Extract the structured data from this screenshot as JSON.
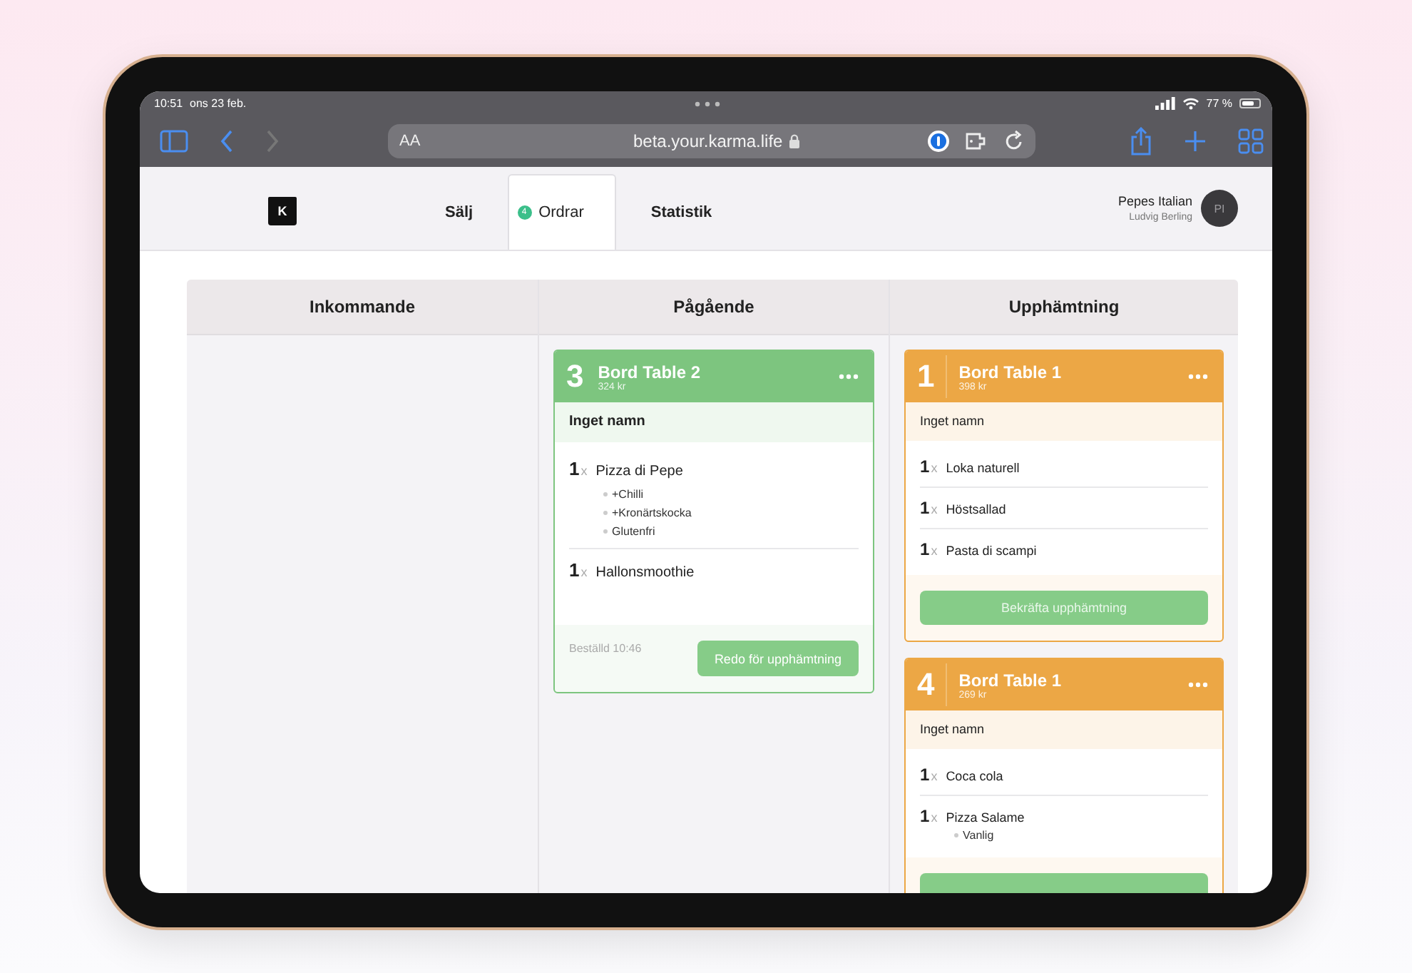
{
  "status_bar": {
    "time": "10:51",
    "date": "ons 23 feb.",
    "battery": "77 %"
  },
  "browser": {
    "text_size": "AA",
    "url": "beta.your.karma.life"
  },
  "nav": {
    "logo_letter": "K",
    "tabs": [
      {
        "label": "Sälj",
        "selected": false
      },
      {
        "label": "Ordrar",
        "badge": "4",
        "selected": true
      },
      {
        "label": "Statistik",
        "selected": false
      }
    ],
    "account": {
      "name": "Pepes Italian",
      "user": "Ludvig Berling",
      "initials": "PI"
    }
  },
  "board": {
    "columns": [
      {
        "title": "Inkommande"
      },
      {
        "title": "Pågående",
        "orders": [
          {
            "number": "3",
            "table": "Bord Table 2",
            "price": "324 kr",
            "color": "#7dc57f",
            "customer": "Inget namn",
            "items": [
              {
                "qty": "1",
                "unit": "x",
                "name": "Pizza di Pepe",
                "options": [
                  "+Chilli",
                  "+Kronärtskocka",
                  "Glutenfri"
                ]
              },
              {
                "qty": "1",
                "unit": "x",
                "name": "Hallonsmoothie"
              }
            ],
            "ordered": "Beställd 10:46",
            "action": "Redo för upphämtning",
            "kind": "side"
          }
        ]
      },
      {
        "title": "Upphämtning",
        "orders": [
          {
            "number": "1",
            "table": "Bord Table 1",
            "price": "398 kr",
            "color": "#eca745",
            "customer": "Inget namn",
            "items": [
              {
                "qty": "1",
                "unit": "x",
                "name": "Loka naturell"
              },
              {
                "qty": "1",
                "unit": "x",
                "name": "Höstsallad"
              },
              {
                "qty": "1",
                "unit": "x",
                "name": "Pasta di scampi"
              }
            ],
            "action": "Bekräfta upphämtning",
            "kind": "full"
          },
          {
            "number": "4",
            "table": "Bord Table 1",
            "price": "269 kr",
            "color": "#eca745",
            "customer": "Inget namn",
            "items": [
              {
                "qty": "1",
                "unit": "x",
                "name": "Coca cola"
              },
              {
                "qty": "1",
                "unit": "x",
                "name": "Pizza Salame",
                "options": [
                  "Vanlig"
                ]
              }
            ],
            "kind": "full"
          }
        ]
      }
    ]
  }
}
